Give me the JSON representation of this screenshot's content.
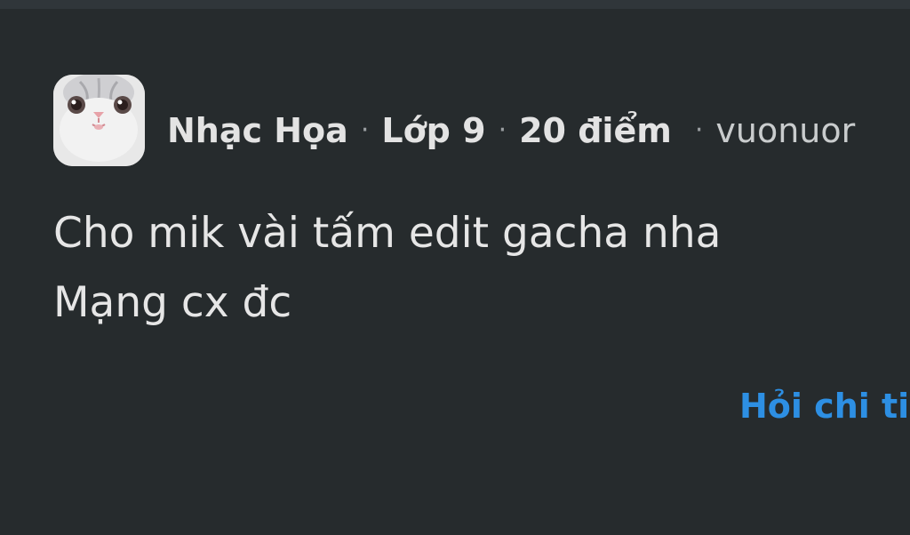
{
  "post": {
    "author": {
      "name": "Nhạc Họa",
      "grade": "Lớp 9",
      "points": "20 điểm",
      "handle": "vuonuor",
      "avatar_icon": "cat-avatar-icon"
    },
    "separator": "·",
    "body_lines": [
      "Cho mik vài tấm edit gacha nha",
      "Mạng cx đc"
    ],
    "ask_link_label": "Hỏi chi ti"
  },
  "colors": {
    "background": "#262b2d",
    "text": "#e6e6e6",
    "muted": "#9a9ea1",
    "link": "#2d8fe3"
  }
}
